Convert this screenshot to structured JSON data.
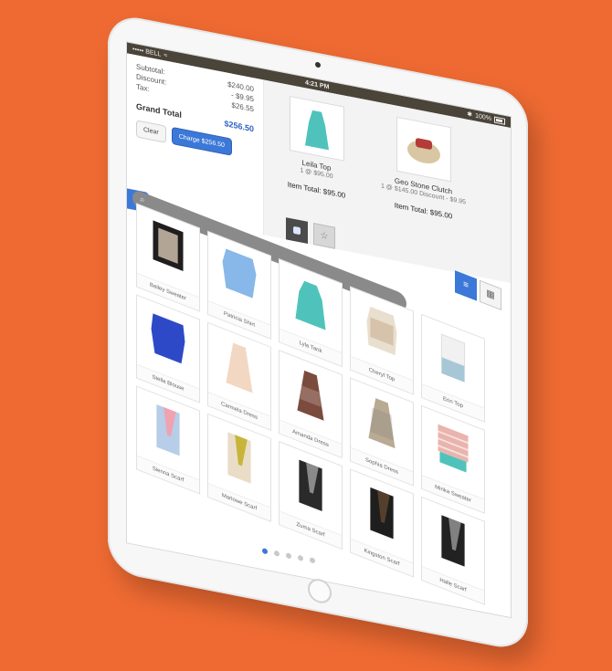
{
  "status": {
    "carrier": "••••• BELL",
    "time": "4:21 PM",
    "battery": "100%"
  },
  "summary": {
    "subtotal_label": "Subtotal:",
    "subtotal_value": "$240.00",
    "discount_label": "Discount:",
    "discount_value": "- $9.95",
    "tax_label": "Tax:",
    "tax_value": "$26.55",
    "grand_total_label": "Grand Total",
    "grand_total_value": "$256.50",
    "clear_label": "Clear",
    "charge_label": "Charge $256.50"
  },
  "cart": {
    "items": [
      {
        "name": "Leila Top",
        "sub": "1 @ $95.00",
        "total": "Item Total: $95.00"
      },
      {
        "name": "Geo Stone Clutch",
        "sub": "1 @ $145.00\nDiscount - $9.95",
        "total": "Item Total: $95.00"
      }
    ]
  },
  "products": [
    {
      "name": "Bailey Sweater",
      "color": "#1e1e1e"
    },
    {
      "name": "Patricia Shirt",
      "color": "#88b7ea"
    },
    {
      "name": "Lyla Tank",
      "color": "#4fc3bb"
    },
    {
      "name": "Cheryl Top",
      "color": "#e9dfcf"
    },
    {
      "name": "Erin Top",
      "color": "#f1f1f1"
    },
    {
      "name": "Stella Blouse",
      "color": "#2e49c8"
    },
    {
      "name": "Carmela Dress",
      "color": "#f2d7c2"
    },
    {
      "name": "Amanda Dress",
      "color": "#7b4b3e"
    },
    {
      "name": "Sophia Dress",
      "color": "#b9aa94"
    },
    {
      "name": "Minka Sweater",
      "color": "#e9b4ad"
    },
    {
      "name": "Sienna Scarf",
      "color": "#f0a2b0"
    },
    {
      "name": "Marlowe Scarf",
      "color": "#c7b43a"
    },
    {
      "name": "Zuma Scarf",
      "color": "#8a8a8a"
    },
    {
      "name": "Kingston Scarf",
      "color": "#553f2c"
    },
    {
      "name": "Halle Scarf",
      "color": "#222222"
    }
  ],
  "colors": {
    "accent": "#3b78d8",
    "background": "#ee6a32"
  }
}
